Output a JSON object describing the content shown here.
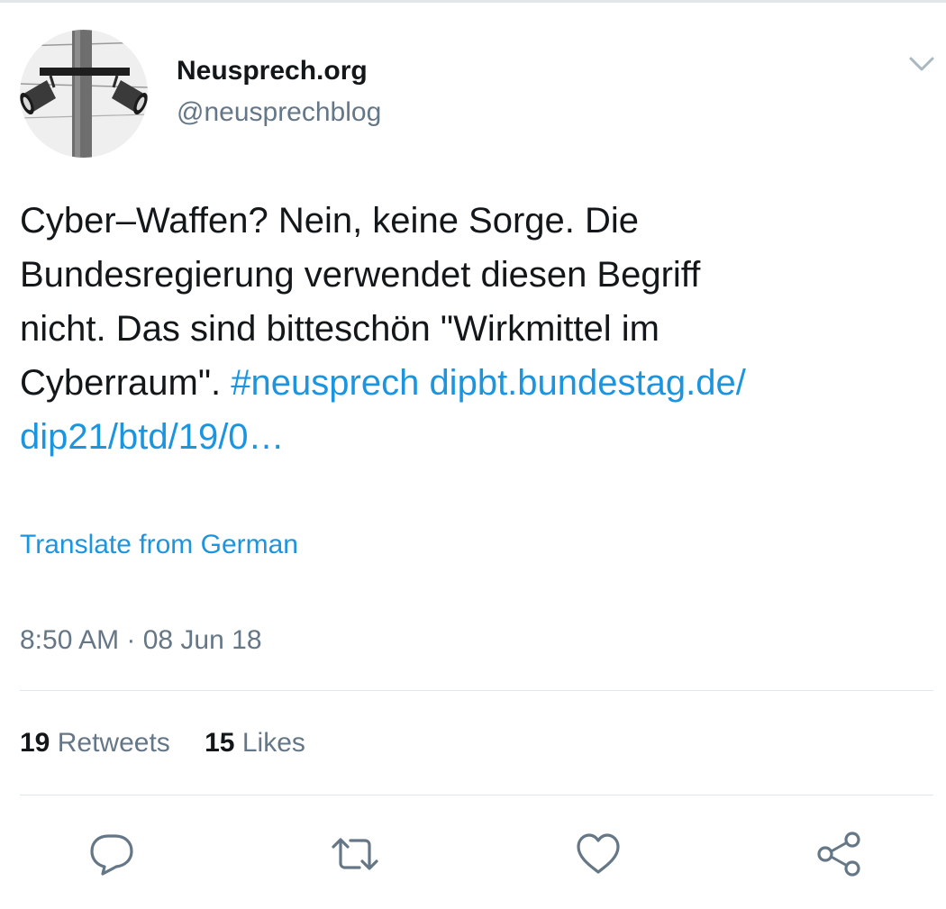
{
  "user": {
    "display_name": "Neusprech.org",
    "handle": "@neusprechblog",
    "avatar_icon": "loudspeaker-pole-avatar"
  },
  "menu": {
    "icon": "chevron-down-icon"
  },
  "tweet": {
    "text_plain": "Cyber–Waffen? Nein, keine Sorge. Die\nBundesregierung verwendet diesen Begriff\nnicht. Das sind bitteschön \"Wirkmittel im\nCyberraum\". ",
    "hashtag": "#neusprech",
    "link_line1": "dipbt.bundestag.de/",
    "link_line2": "dip21/btd/19/0…"
  },
  "translate_label": "Translate from German",
  "timestamp": "8:50 AM · 08 Jun 18",
  "stats": {
    "retweets_count": "19",
    "retweets_label": "Retweets",
    "likes_count": "15",
    "likes_label": "Likes"
  },
  "actions": [
    {
      "icon": "reply-icon"
    },
    {
      "icon": "retweet-icon"
    },
    {
      "icon": "like-icon"
    },
    {
      "icon": "share-icon"
    }
  ],
  "colors": {
    "link": "#1b95e0",
    "secondary_text": "#657786",
    "primary_text": "#14171a",
    "divider": "#e1e8ed"
  }
}
